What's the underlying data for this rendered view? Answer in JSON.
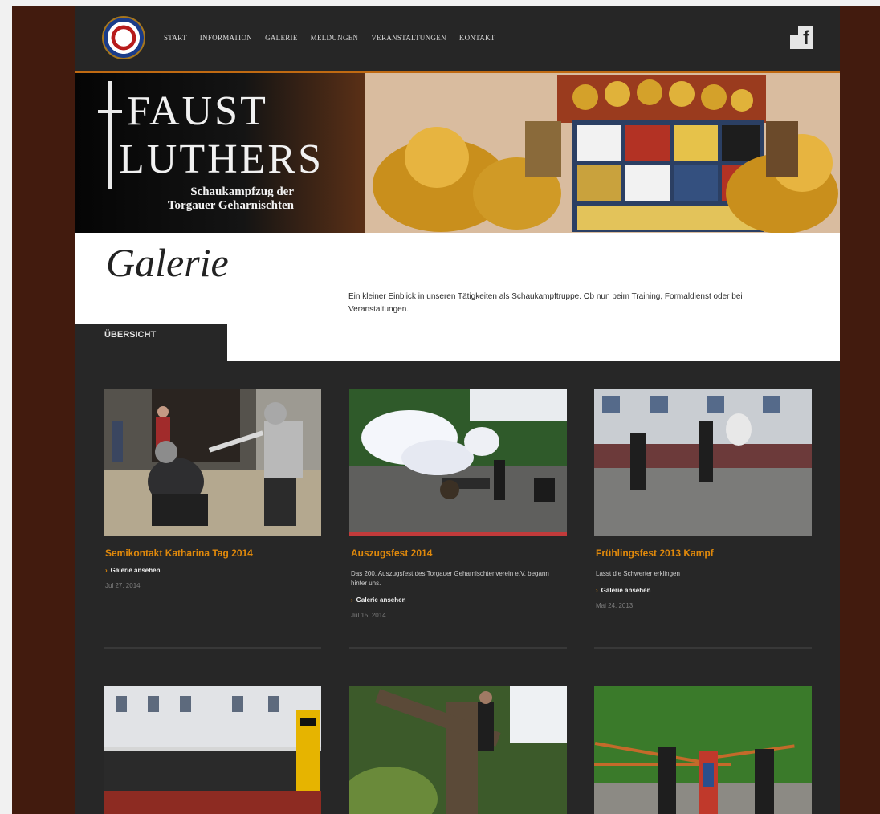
{
  "nav": {
    "items": [
      "START",
      "INFORMATION",
      "GALERIE",
      "MELDUNGEN",
      "VERANSTALTUNGEN",
      "KONTAKT"
    ],
    "social_label": "f"
  },
  "banner": {
    "title_line1": "FAUST",
    "title_line2": "LUTHERS",
    "subtitle_line1": "Schaukampfzug der",
    "subtitle_line2": "Torgauer Geharnischten"
  },
  "page": {
    "title": "Galerie",
    "lead": "Ein kleiner Einblick in unseren Tätigkeiten als Schaukampftruppe. Ob nun beim Training, Formaldienst oder bei Veranstaltungen.",
    "tab": "ÜBERSICHT"
  },
  "gallery": [
    {
      "title": "Semikontakt Katharina Tag 2014",
      "desc": "",
      "link": "Galerie ansehen",
      "date": "Jul 27, 2014"
    },
    {
      "title": "Auszugsfest 2014",
      "desc": "Das 200. Auszugsfest des Torgauer Geharnischtenverein e.V. begann hinter uns.",
      "link": "Galerie ansehen",
      "date": "Jul 15, 2014"
    },
    {
      "title": "Frühlingsfest 2013 Kampf",
      "desc": "Lasst die Schwerter erklingen",
      "link": "Galerie ansehen",
      "date": "Mai 24, 2013"
    }
  ],
  "colors": {
    "accent": "#e0890b",
    "frame": "#421b0e",
    "panel": "#272727"
  }
}
